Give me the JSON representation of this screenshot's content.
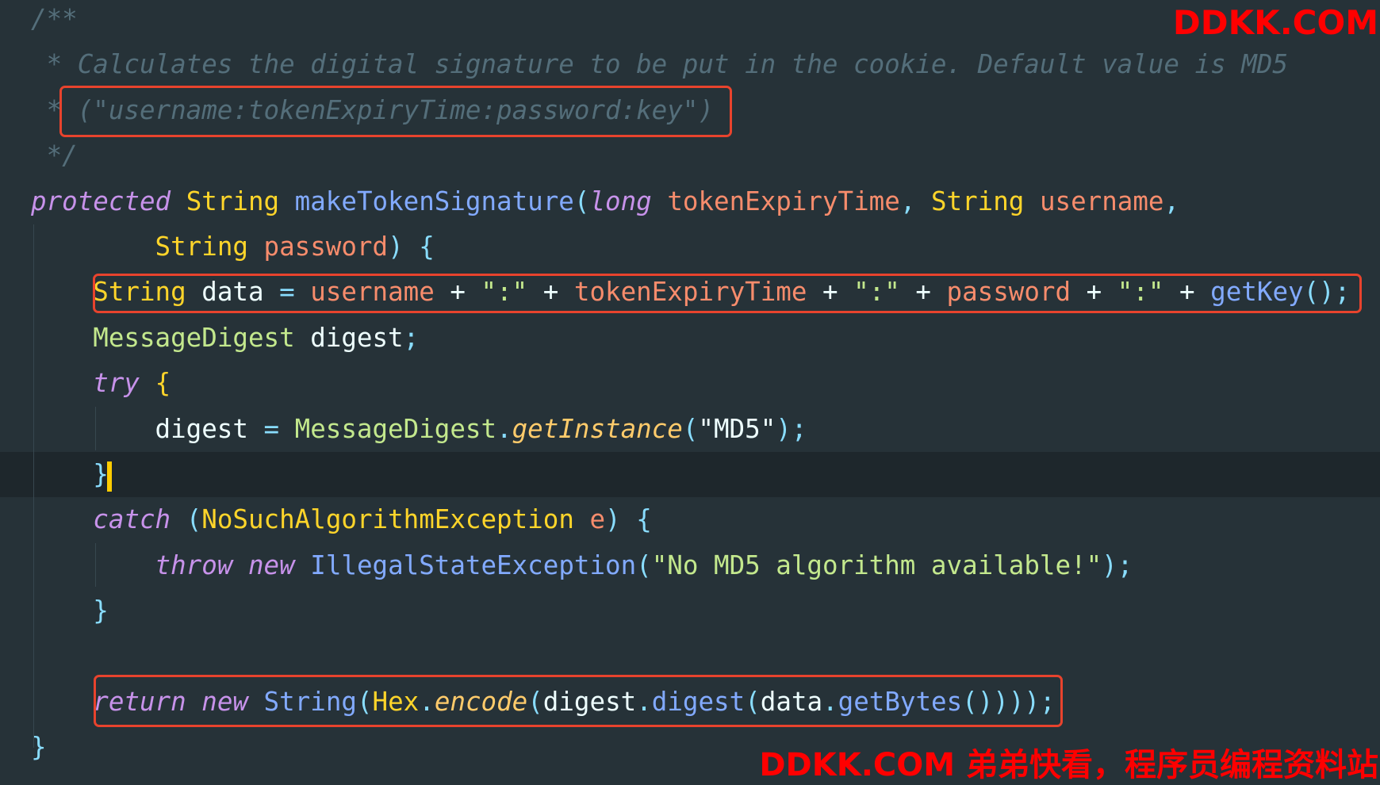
{
  "colors": {
    "background": "#263238",
    "highlight_box": "#e8432d",
    "watermark": "#ff0000",
    "cursor": "#ffcc00"
  },
  "editor": {
    "current_line": 10,
    "lines": [
      [
        [
          "comment",
          "/**"
        ]
      ],
      [
        [
          "comment",
          " * Calculates the digital signature to be put in the cookie. Default value is MD5"
        ]
      ],
      [
        [
          "comment",
          " * (\"username:tokenExpiryTime:password:key\")"
        ]
      ],
      [
        [
          "comment",
          " */"
        ]
      ],
      [
        [
          "kw",
          "protected"
        ],
        [
          "plain",
          " "
        ],
        [
          "type",
          "String"
        ],
        [
          "plain",
          " "
        ],
        [
          "fn",
          "makeTokenSignature"
        ],
        [
          "punc",
          "("
        ],
        [
          "kw",
          "long"
        ],
        [
          "plain",
          " "
        ],
        [
          "param",
          "tokenExpiryTime"
        ],
        [
          "punc",
          ","
        ],
        [
          "plain",
          " "
        ],
        [
          "type",
          "String"
        ],
        [
          "plain",
          " "
        ],
        [
          "param",
          "username"
        ],
        [
          "punc",
          ","
        ]
      ],
      [
        [
          "plain",
          "        "
        ],
        [
          "type",
          "String"
        ],
        [
          "plain",
          " "
        ],
        [
          "param",
          "password"
        ],
        [
          "punc",
          ")"
        ],
        [
          "plain",
          " "
        ],
        [
          "punc",
          "{"
        ]
      ],
      [
        [
          "plain",
          "    "
        ],
        [
          "type",
          "String"
        ],
        [
          "plain",
          " data "
        ],
        [
          "punc",
          "="
        ],
        [
          "plain",
          " "
        ],
        [
          "param",
          "username"
        ],
        [
          "plain",
          " + "
        ],
        [
          "str",
          "\":\""
        ],
        [
          "plain",
          " + "
        ],
        [
          "param",
          "tokenExpiryTime"
        ],
        [
          "plain",
          " + "
        ],
        [
          "str",
          "\":\""
        ],
        [
          "plain",
          " + "
        ],
        [
          "param",
          "password"
        ],
        [
          "plain",
          " + "
        ],
        [
          "str",
          "\":\""
        ],
        [
          "plain",
          " + "
        ],
        [
          "fn",
          "getKey"
        ],
        [
          "punc",
          "();"
        ]
      ],
      [
        [
          "plain",
          "    "
        ],
        [
          "cls",
          "MessageDigest"
        ],
        [
          "plain",
          " digest"
        ],
        [
          "punc",
          ";"
        ]
      ],
      [
        [
          "plain",
          "    "
        ],
        [
          "kw",
          "try"
        ],
        [
          "plain",
          " "
        ],
        [
          "type",
          "{"
        ]
      ],
      [
        [
          "plain",
          "        digest "
        ],
        [
          "punc",
          "="
        ],
        [
          "plain",
          " "
        ],
        [
          "cls",
          "MessageDigest"
        ],
        [
          "punc",
          "."
        ],
        [
          "fni",
          "getInstance"
        ],
        [
          "punc",
          "("
        ],
        [
          "plain",
          "\"MD5\""
        ],
        [
          "punc",
          ");"
        ]
      ],
      [
        [
          "plain",
          "    "
        ],
        [
          "punc",
          "}"
        ]
      ],
      [
        [
          "plain",
          "    "
        ],
        [
          "kw",
          "catch"
        ],
        [
          "plain",
          " "
        ],
        [
          "punc",
          "("
        ],
        [
          "type",
          "NoSuchAlgorithmException"
        ],
        [
          "plain",
          " "
        ],
        [
          "param",
          "e"
        ],
        [
          "punc",
          ")"
        ],
        [
          "plain",
          " "
        ],
        [
          "punc",
          "{"
        ]
      ],
      [
        [
          "plain",
          "        "
        ],
        [
          "kw",
          "throw"
        ],
        [
          "plain",
          " "
        ],
        [
          "kw",
          "new"
        ],
        [
          "plain",
          " "
        ],
        [
          "fn",
          "IllegalStateException"
        ],
        [
          "punc",
          "("
        ],
        [
          "str",
          "\"No MD5 algorithm available!\""
        ],
        [
          "punc",
          ");"
        ]
      ],
      [
        [
          "plain",
          "    "
        ],
        [
          "punc",
          "}"
        ]
      ],
      [
        [
          "plain",
          ""
        ]
      ],
      [
        [
          "plain",
          "    "
        ],
        [
          "kw",
          "return"
        ],
        [
          "plain",
          " "
        ],
        [
          "kw",
          "new"
        ],
        [
          "plain",
          " "
        ],
        [
          "fn",
          "String"
        ],
        [
          "punc",
          "("
        ],
        [
          "type",
          "Hex"
        ],
        [
          "punc",
          "."
        ],
        [
          "fni",
          "encode"
        ],
        [
          "punc",
          "("
        ],
        [
          "plain",
          "digest"
        ],
        [
          "punc",
          "."
        ],
        [
          "fn",
          "digest"
        ],
        [
          "punc",
          "("
        ],
        [
          "plain",
          "data"
        ],
        [
          "punc",
          "."
        ],
        [
          "fn",
          "getBytes"
        ],
        [
          "punc",
          "()))"
        ],
        [
          "punc",
          ");"
        ]
      ],
      [
        [
          "punc",
          "}"
        ]
      ]
    ]
  },
  "watermark": {
    "top": "DDKK.COM",
    "bottom": "DDKK.COM 弟弟快看，程序员编程资料站"
  }
}
